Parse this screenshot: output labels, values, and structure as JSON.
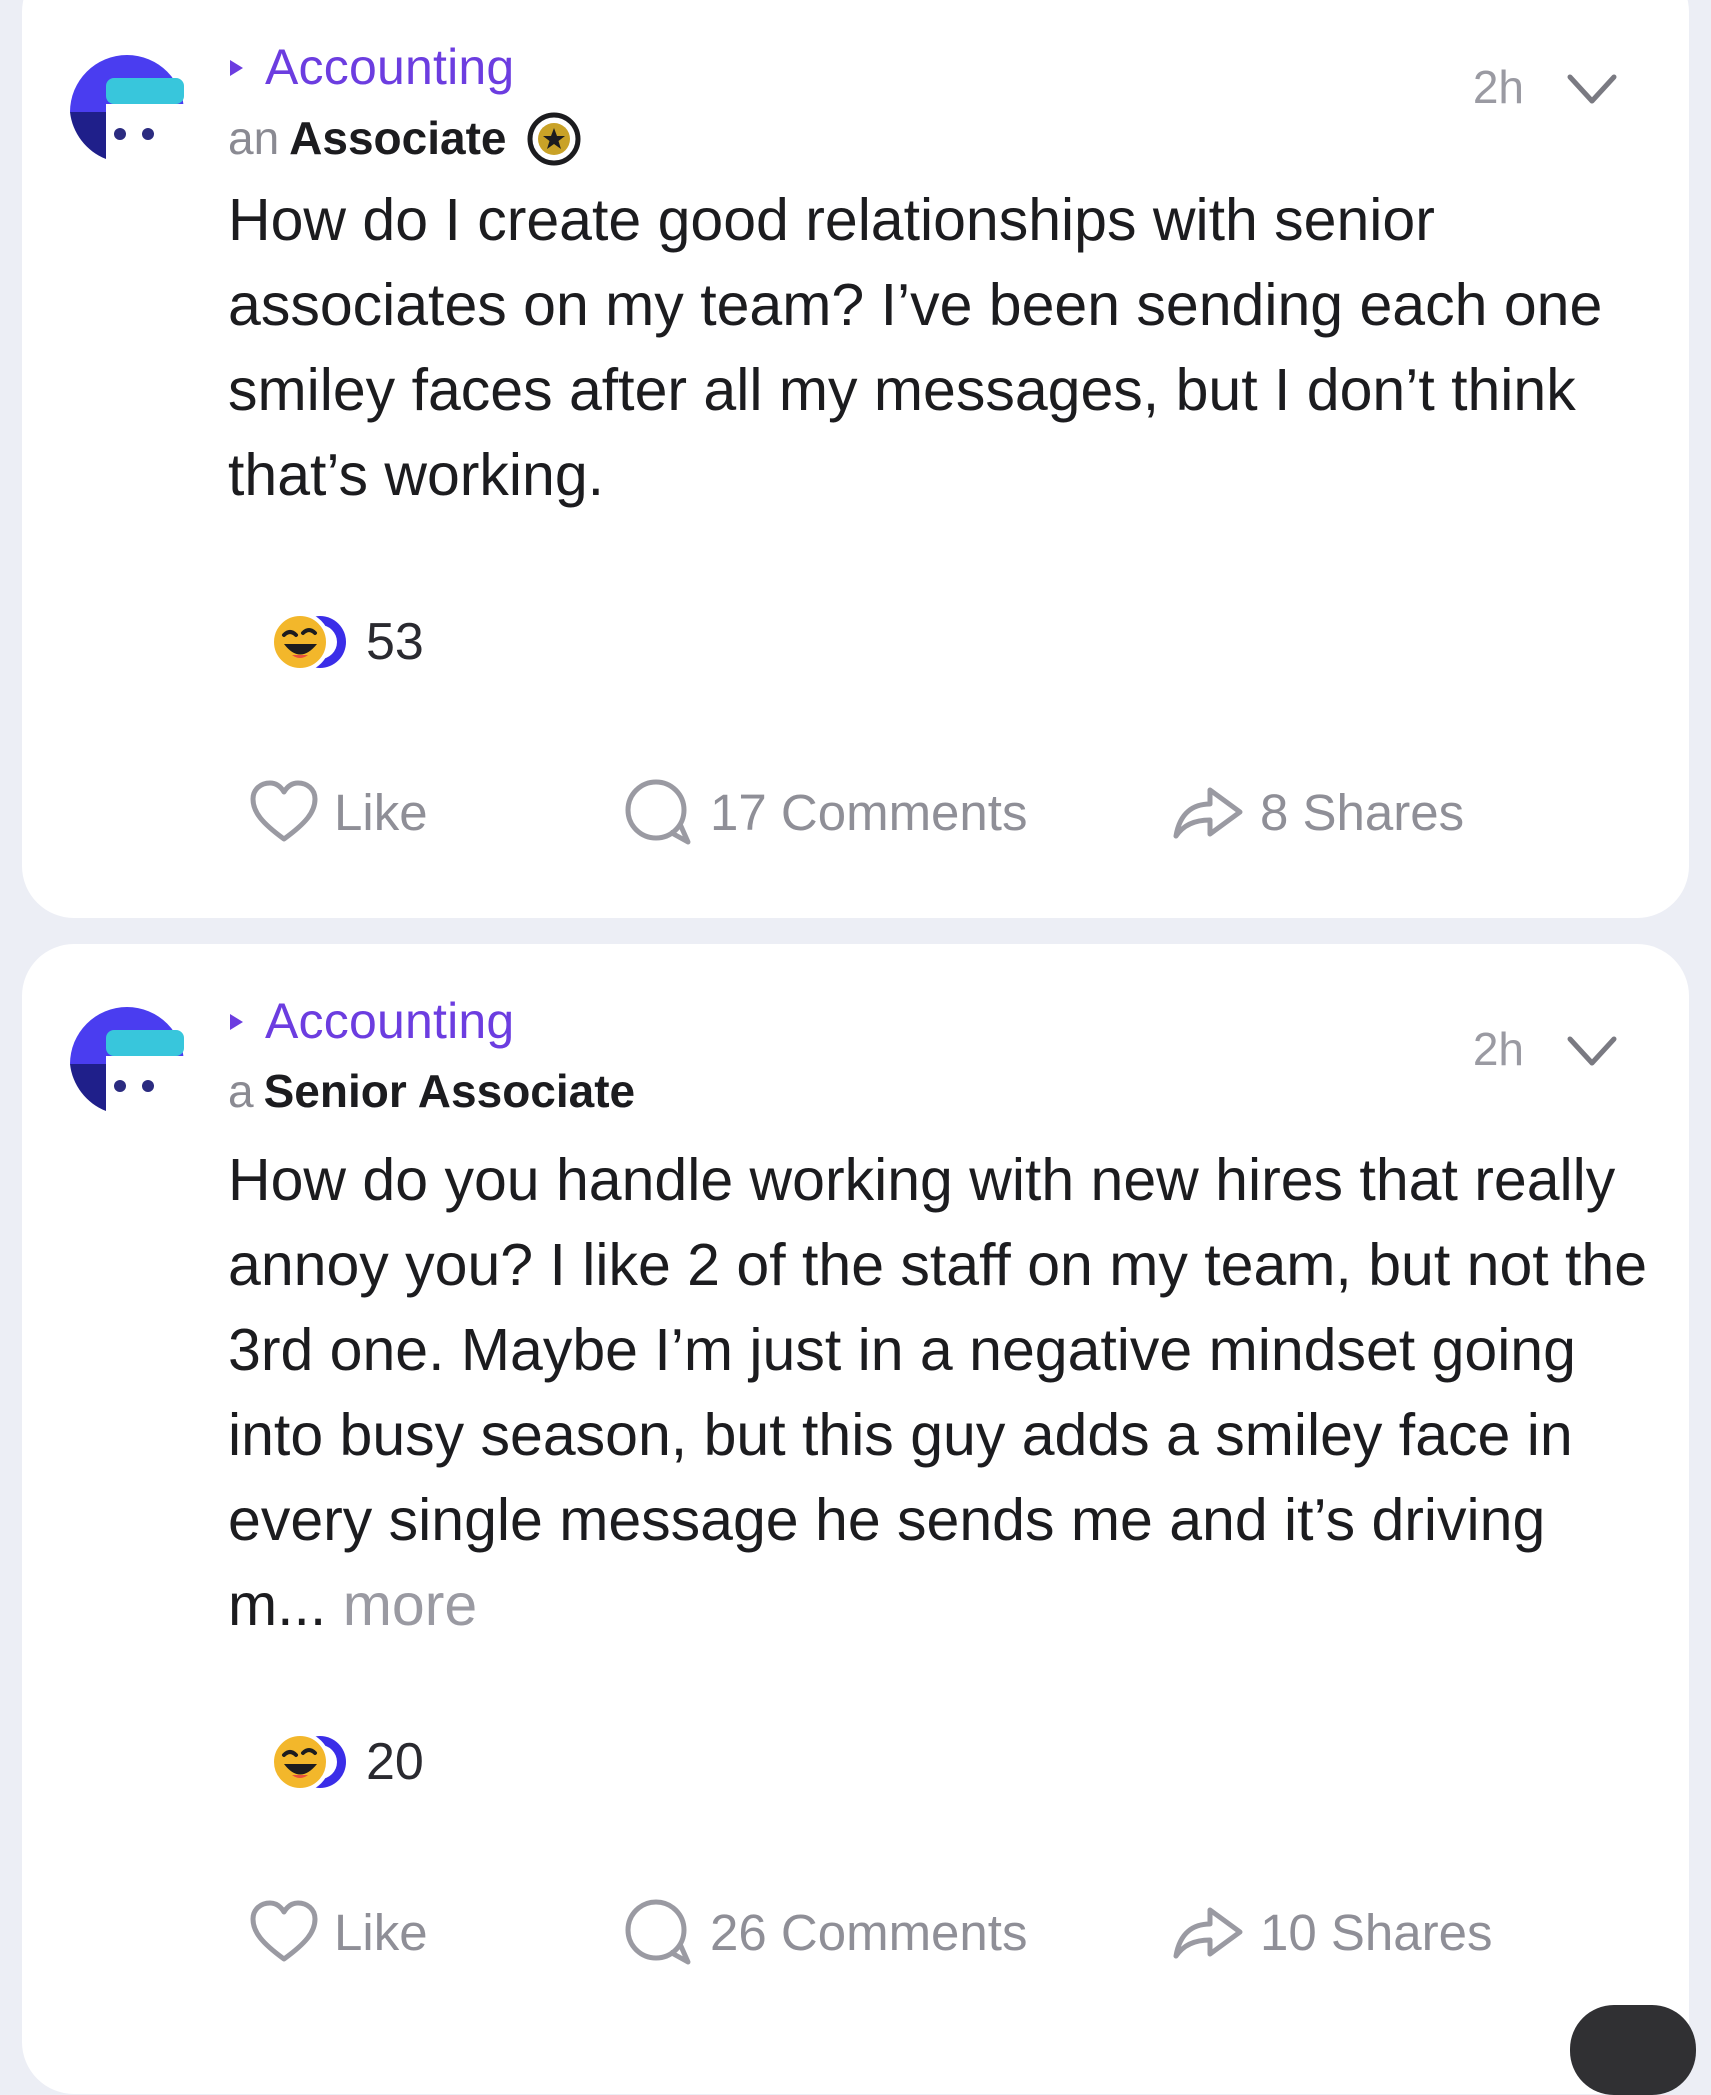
{
  "posts": [
    {
      "category": "Accounting",
      "role_article": "an",
      "role": "Associate",
      "time": "2h",
      "body": "How do I create good relationships with senior associates on my team? I’ve been sending each one smiley faces after all my messages, but I don’t think that’s working.",
      "more_label": "",
      "reaction_icon": "laughing-face-icon",
      "reaction_count": "53",
      "like_label": "Like",
      "comments_label": "17 Comments",
      "shares_label": "8 Shares"
    },
    {
      "category": "Accounting",
      "role_article": "a",
      "role": "Senior Associate",
      "time": "2h",
      "body": "How do you handle working with new hires that really annoy you? I like 2 of the staff on my team, but not the 3rd one. Maybe I’m just in a negative mindset going into busy season, but this guy adds a smiley face in every single message he sends me and it’s driving m...",
      "more_label": "more",
      "reaction_icon": "laughing-face-icon",
      "reaction_count": "20",
      "like_label": "Like",
      "comments_label": "26 Comments",
      "shares_label": "10 Shares"
    }
  ],
  "colors": {
    "accent": "#6c3de0",
    "avatar_blue": "#4a3df0",
    "avatar_cyan": "#38c6dc",
    "background": "#eceef5",
    "card": "#ffffff",
    "muted_text": "#8f8f97"
  }
}
